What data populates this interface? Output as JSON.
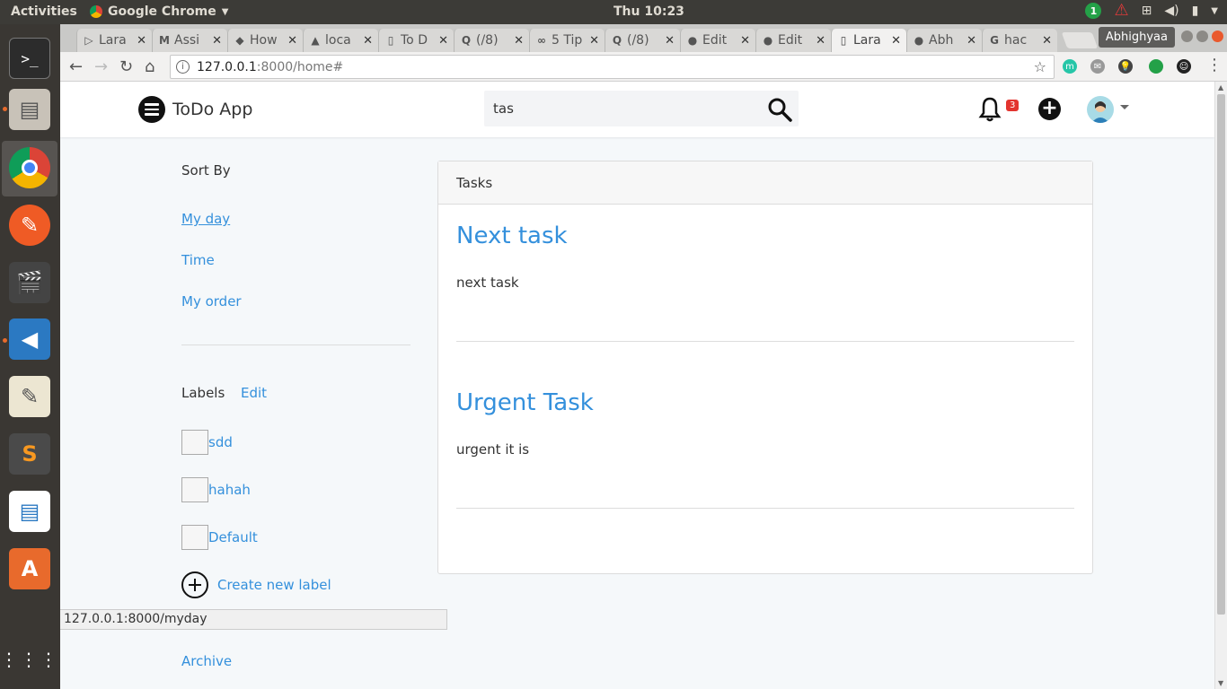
{
  "system": {
    "activities": "Activities",
    "app_name": "Google Chrome",
    "clock": "Thu 10:23",
    "notif_count": "1"
  },
  "browser": {
    "tabs": [
      {
        "label": "Lara",
        "fav": "▷"
      },
      {
        "label": "Assi",
        "fav": "M"
      },
      {
        "label": "How",
        "fav": "◆"
      },
      {
        "label": "loca",
        "fav": "▲"
      },
      {
        "label": "To D",
        "fav": "▯"
      },
      {
        "label": "(/8)",
        "fav": "Q"
      },
      {
        "label": "5 Tip",
        "fav": "∞"
      },
      {
        "label": "(/8)",
        "fav": "Q"
      },
      {
        "label": "Edit",
        "fav": "●"
      },
      {
        "label": "Edit",
        "fav": "●"
      },
      {
        "label": "Lara",
        "fav": "▯"
      },
      {
        "label": "Abh",
        "fav": "●"
      },
      {
        "label": "hac",
        "fav": "G"
      }
    ],
    "active_tab_index": 10,
    "profile_name": "Abhighyaa",
    "url_host": "127.0.0.1",
    "url_path": ":8000/home#",
    "status_url": "127.0.0.1:8000/myday"
  },
  "app": {
    "brand": "ToDo App",
    "search_value": "tas",
    "notification_count": "3"
  },
  "sidebar": {
    "sort_heading": "Sort By",
    "sort_items": [
      "My day",
      "Time",
      "My order"
    ],
    "labels_heading": "Labels",
    "labels_edit": "Edit",
    "labels": [
      "sdd",
      "hahah",
      "Default"
    ],
    "create_label": "Create new label",
    "archive": "Archive"
  },
  "tasks_panel": {
    "heading": "Tasks",
    "tasks": [
      {
        "title": "Next task",
        "description": "next task"
      },
      {
        "title": "Urgent Task",
        "description": "urgent it is"
      }
    ]
  },
  "colors": {
    "link": "#3490dc",
    "badge": "#e3342f"
  }
}
